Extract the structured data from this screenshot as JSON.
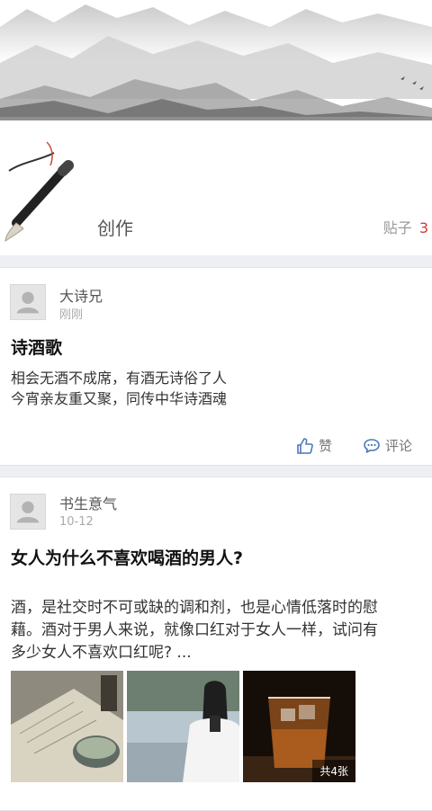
{
  "header": {
    "title": "创作",
    "post_count_label": "贴子",
    "post_count": "3"
  },
  "posts": [
    {
      "author": "大诗兄",
      "time": "刚刚",
      "title": "诗酒歌",
      "lines": [
        "相会无酒不成席，有酒无诗俗了人",
        "今宵亲友重又聚，同传中华诗酒魂"
      ],
      "like_label": "赞",
      "comment_label": "评论"
    },
    {
      "author": "书生意气",
      "time": "10-12",
      "title": "女人为什么不喜欢喝酒的男人?",
      "lines": [
        "酒，是社交时不可或缺的调和剂，也是心情低落时的慰",
        "藉。酒对于男人来说，就像口红对于女人一样，试问有",
        "多少女人不喜欢口红呢? ..."
      ],
      "photo_count": "共4张"
    }
  ],
  "icons": {
    "like": "thumbs-up-icon",
    "comment": "comment-bubble-icon",
    "avatar": "default-avatar-icon"
  },
  "colors": {
    "accent_red": "#d23a3a",
    "icon_blue": "#4a78b8"
  }
}
